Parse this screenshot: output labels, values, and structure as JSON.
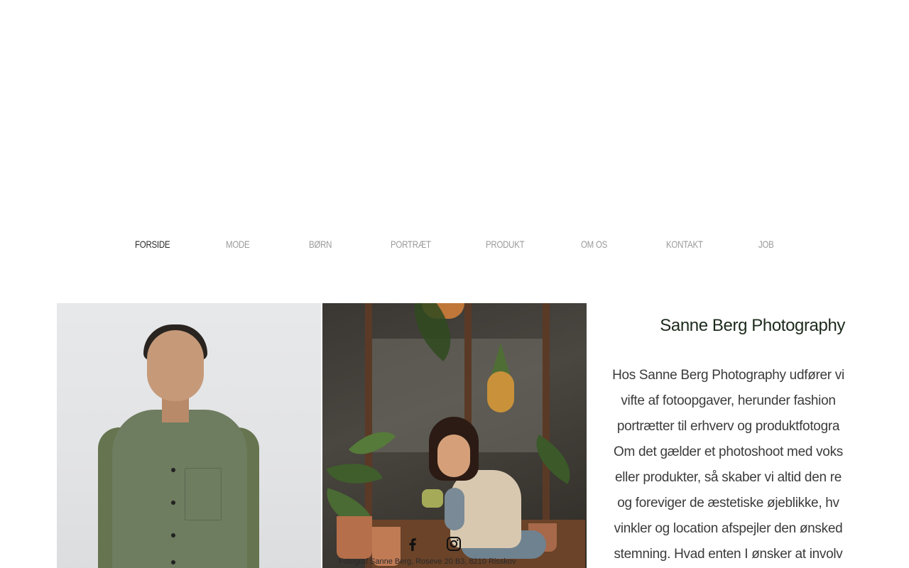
{
  "nav": {
    "items": [
      {
        "label": "FORSIDE",
        "active": true
      },
      {
        "label": "MODE",
        "active": false
      },
      {
        "label": "BØRN",
        "active": false
      },
      {
        "label": "PORTRÆT",
        "active": false
      },
      {
        "label": "PRODUKT",
        "active": false
      },
      {
        "label": "OM OS",
        "active": false
      },
      {
        "label": "KONTAKT",
        "active": false
      },
      {
        "label": "JOB",
        "active": false
      }
    ]
  },
  "brand": {
    "title": "Sanne Berg Photography"
  },
  "about": {
    "lines": [
      "Hos Sanne Berg Photography udfører vi",
      "vifte af fotoopgaver, herunder fashion",
      "portrætter til erhverv og produktfotogra",
      "Om det gælder et photoshoot med voks",
      "eller produkter, så skaber vi altid den re",
      "og foreviger de æstetiske øjeblikke, hv",
      "vinkler og location afspejler den ønsked",
      "stemning. Hvad enten I ønsker at involv"
    ]
  },
  "social": {
    "facebook_icon": "facebook-icon",
    "instagram_icon": "instagram-icon"
  },
  "footer": {
    "address": "Fotograf Sanne Berg, Roseve 20 B3, 8210 Risskov"
  },
  "colors": {
    "nav_active": "#2b2b2b",
    "nav_inactive": "#9a9a9a",
    "title": "#1c2a1c",
    "body_text": "#3b3b3b"
  }
}
